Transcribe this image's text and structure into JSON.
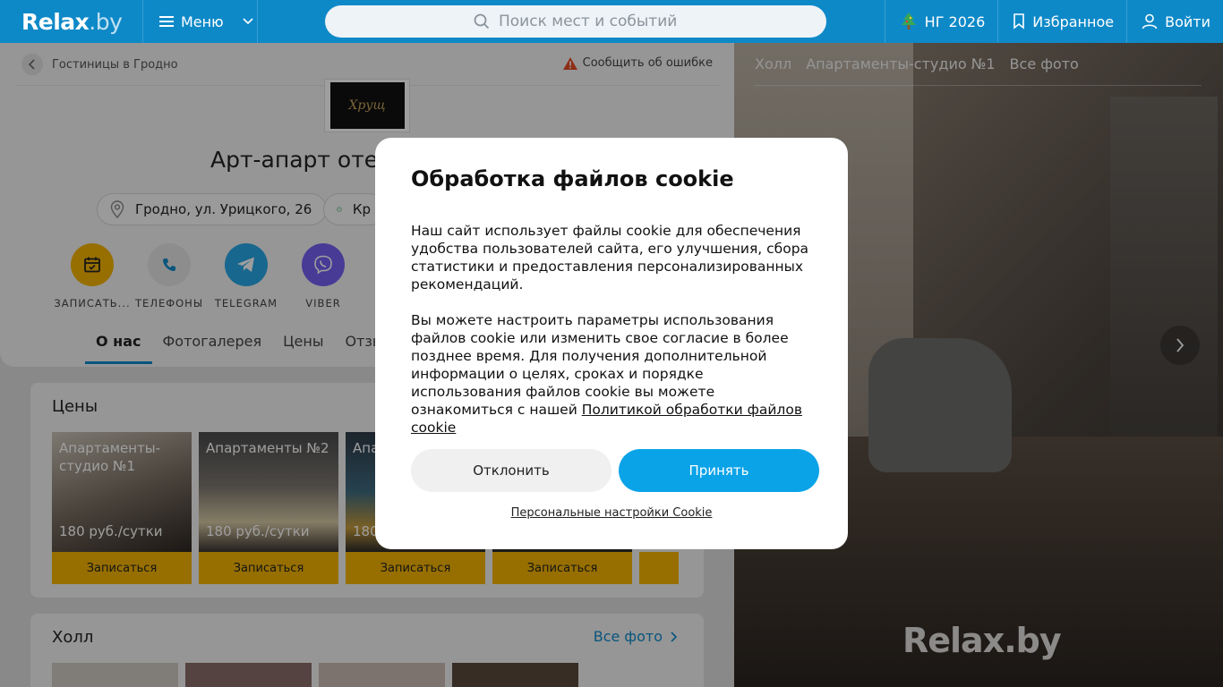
{
  "header": {
    "logo": "Relax",
    "logo_suffix": ".by",
    "menu_label": "Меню",
    "search_placeholder": "Поиск мест и событий",
    "ny_label": "НГ 2026",
    "favorites_label": "Избранное",
    "login_label": "Войти"
  },
  "breadcrumb": {
    "label": "Гостиницы в Гродно"
  },
  "report_label": "Сообщить об ошибке",
  "hotel": {
    "logo_text": "Хрущ",
    "title": "Арт-апарт отель",
    "address": "Гродно, ул. Урицкого, 26",
    "hours_partial": "Кр"
  },
  "actions": [
    {
      "label": "ЗАПИСАТЬ...",
      "color": "#f4b400",
      "icon": "calendar-icon"
    },
    {
      "label": "ТЕЛЕФОНЫ",
      "color": "#e4e4e4",
      "icon": "phone-icon"
    },
    {
      "label": "TELEGRAM",
      "color": "#27a6e5",
      "icon": "telegram-icon"
    },
    {
      "label": "VIBER",
      "color": "#7360f2",
      "icon": "viber-icon"
    }
  ],
  "tabs": [
    "О нас",
    "Фотогалерея",
    "Цены",
    "Отзывы"
  ],
  "prices": {
    "title": "Цены",
    "rooms": [
      {
        "name": "Апартаменты-студио №1",
        "price": "180 руб./сутки",
        "book": "Записаться"
      },
      {
        "name": "Апартаменты №2",
        "price": "180 руб./сутки",
        "book": "Записаться"
      },
      {
        "name": "Апа",
        "price": "180",
        "book": "Записаться"
      },
      {
        "name": "",
        "price": "",
        "book": "Записаться"
      }
    ]
  },
  "hall": {
    "title": "Холл",
    "all_photos": "Все фото"
  },
  "gallery": {
    "tabs": [
      "Холл",
      "Апартаменты-студио №1",
      "Все фото"
    ],
    "watermark": "Relax.by"
  },
  "cookie": {
    "title": "Обработка файлов cookie",
    "p1": "Наш сайт использует файлы cookie для обеспечения удобства пользователей сайта, его улучшения, сбора статистики и предоставления персонализированных рекомендаций.",
    "p2": "Вы можете настроить параметры использования файлов cookie или изменить свое согласие в более позднее время. Для получения дополнительной информации о целях, сроках и порядке использования файлов cookie вы можете ознакомиться с нашей",
    "policy_link": "Политикой обработки файлов cookie",
    "decline": "Отклонить",
    "accept": "Принять",
    "personal": "Персональные настройки Cookie"
  }
}
